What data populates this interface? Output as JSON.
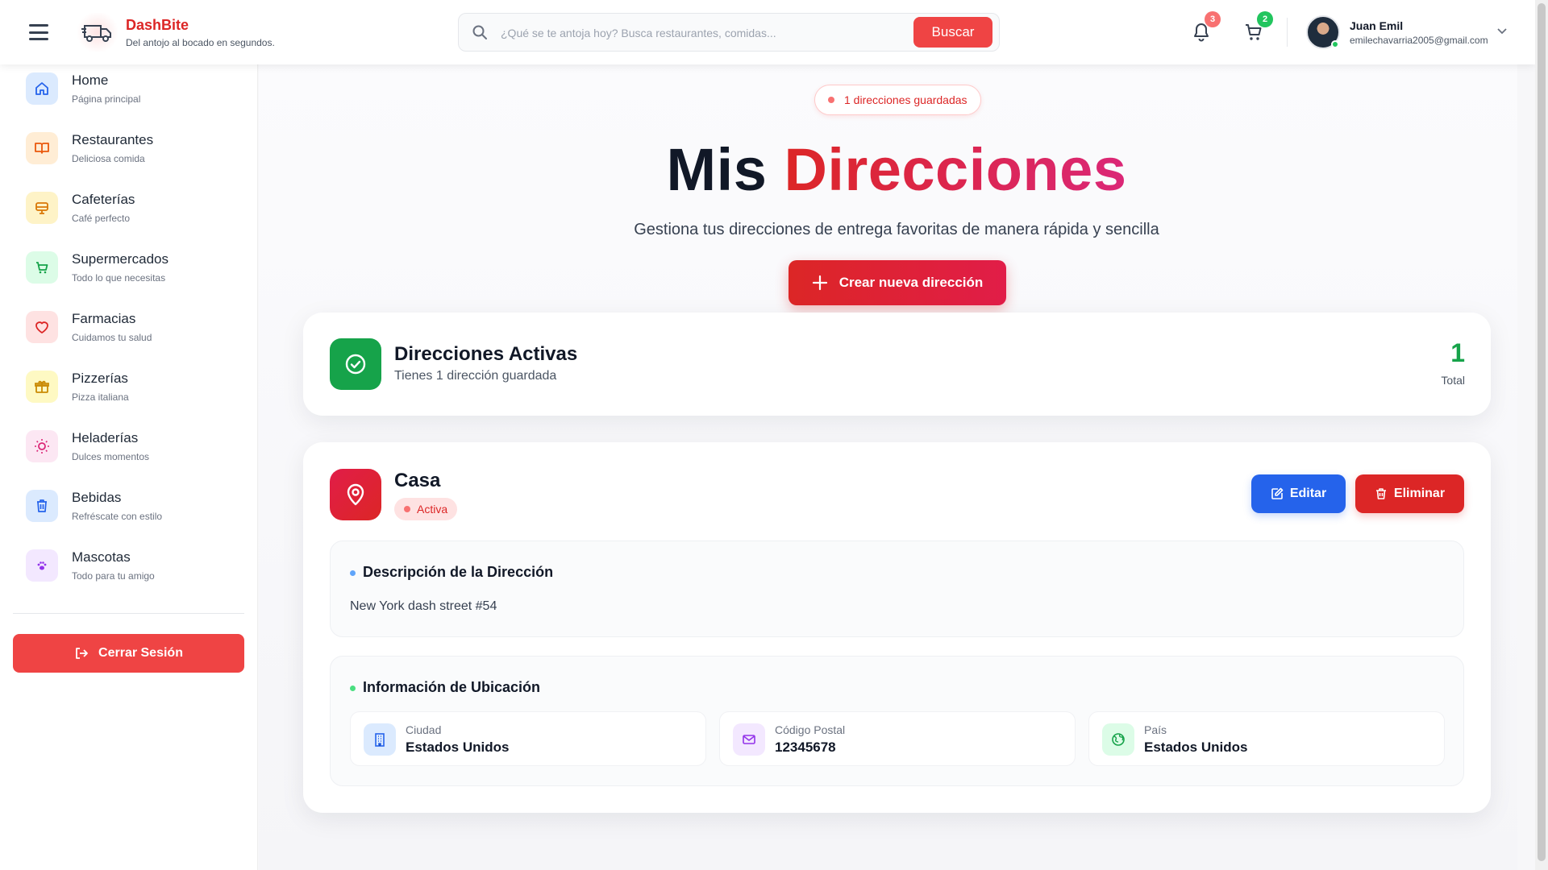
{
  "brand": {
    "name": "DashBite",
    "tagline": "Del antojo al bocado en segundos."
  },
  "search": {
    "placeholder": "¿Qué se te antoja hoy? Busca restaurantes, comidas...",
    "button_label": "Buscar"
  },
  "header": {
    "notifications": {
      "icon": "bell-icon",
      "count": "3",
      "badge_color": "#f87171"
    },
    "cart": {
      "icon": "cart-icon",
      "count": "2",
      "badge_color": "#22c55e"
    },
    "user": {
      "name": "Juan Emil",
      "email": "emilechavarria2005@gmail.com"
    }
  },
  "sidebar": {
    "items": [
      {
        "label": "Home",
        "sub": "Página principal",
        "icon": "home-icon",
        "color": "#2563eb",
        "bg": "#dbeafe"
      },
      {
        "label": "Restaurantes",
        "sub": "Deliciosa comida",
        "icon": "book-icon",
        "color": "#ea580c",
        "bg": "#ffedd5"
      },
      {
        "label": "Cafeterías",
        "sub": "Café perfecto",
        "icon": "monitor-icon",
        "color": "#d97706",
        "bg": "#fef3c7"
      },
      {
        "label": "Supermercados",
        "sub": "Todo lo que necesitas",
        "icon": "cart-icon",
        "color": "#16a34a",
        "bg": "#dcfce7"
      },
      {
        "label": "Farmacias",
        "sub": "Cuidamos tu salud",
        "icon": "heart-icon",
        "color": "#dc2626",
        "bg": "#fee2e2"
      },
      {
        "label": "Pizzerías",
        "sub": "Pizza italiana",
        "icon": "gift-icon",
        "color": "#ca8a04",
        "bg": "#fef9c3"
      },
      {
        "label": "Heladerías",
        "sub": "Dulces momentos",
        "icon": "bulb-icon",
        "color": "#db2777",
        "bg": "#fce7f3"
      },
      {
        "label": "Bebidas",
        "sub": "Refréscate con estilo",
        "icon": "trash-cup-icon",
        "color": "#2563eb",
        "bg": "#dbeafe"
      },
      {
        "label": "Mascotas",
        "sub": "Todo para tu amigo",
        "icon": "paw-icon",
        "color": "#9333ea",
        "bg": "#f3e8ff"
      }
    ],
    "logout_label": "Cerrar Sesión"
  },
  "main": {
    "saved_pill": "1 direcciones guardadas",
    "title_part1": "Mis",
    "title_part2": "Direcciones",
    "subtitle": "Gestiona tus direcciones de entrega favoritas de manera rápida y sencilla",
    "create_label": "Crear nueva dirección",
    "stats": {
      "title": "Direcciones Activas",
      "subtitle": "Tienes 1 dirección guardada",
      "count": "1",
      "count_label": "Total"
    },
    "address": {
      "name": "Casa",
      "status": "Activa",
      "edit_label": "Editar",
      "delete_label": "Eliminar",
      "description_title": "Descripción de la Dirección",
      "description": "New York dash street #54",
      "location_title": "Información de Ubicación",
      "location": [
        {
          "label": "Ciudad",
          "value": "Estados Unidos",
          "icon": "building-icon",
          "color": "#2563eb",
          "bg": "#dbeafe"
        },
        {
          "label": "Código Postal",
          "value": "12345678",
          "icon": "mail-icon",
          "color": "#9333ea",
          "bg": "#f3e8ff"
        },
        {
          "label": "País",
          "value": "Estados Unidos",
          "icon": "globe-icon",
          "color": "#16a34a",
          "bg": "#dcfce7"
        }
      ]
    }
  }
}
